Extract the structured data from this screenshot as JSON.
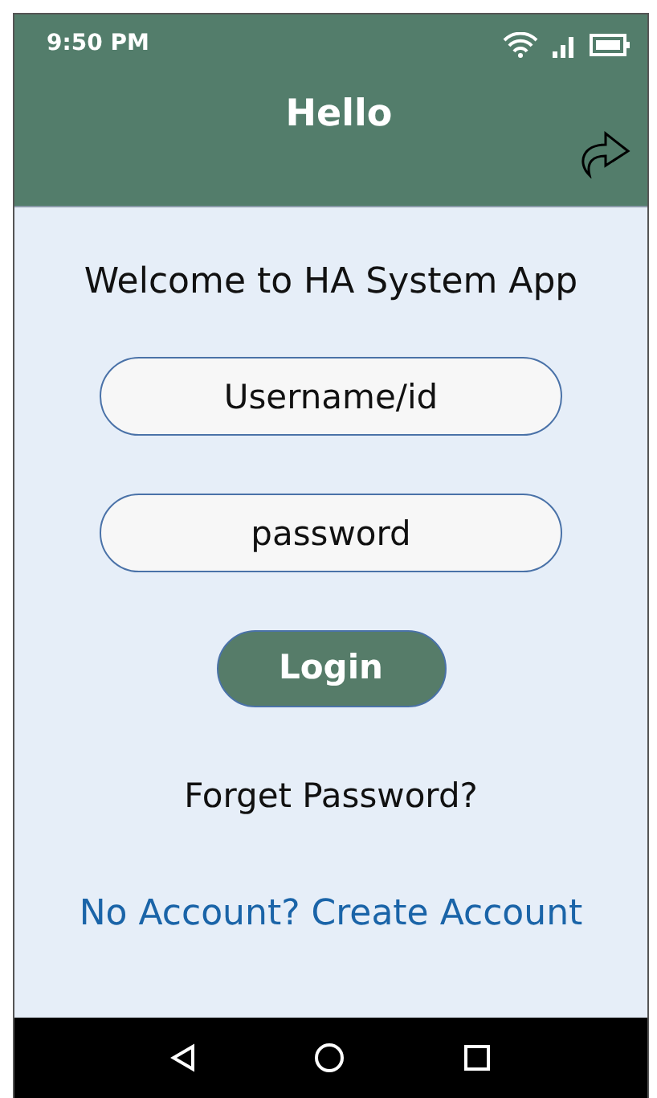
{
  "status_bar": {
    "time": "9:50 PM"
  },
  "header": {
    "title": "Hello"
  },
  "welcome": "Welcome to HA System App",
  "fields": [
    {
      "placeholder": "Username/id"
    },
    {
      "placeholder": "password"
    }
  ],
  "login_button": "Login",
  "forgot_link": "Forget Password?",
  "create_account_link": "No Account? Create Account"
}
